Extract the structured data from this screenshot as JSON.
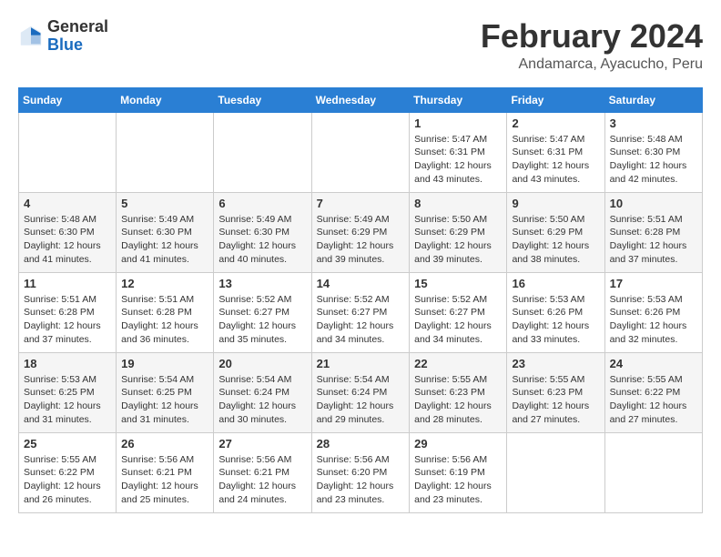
{
  "header": {
    "logo": {
      "general": "General",
      "blue": "Blue"
    },
    "title": "February 2024",
    "subtitle": "Andamarca, Ayacucho, Peru"
  },
  "days_of_week": [
    "Sunday",
    "Monday",
    "Tuesday",
    "Wednesday",
    "Thursday",
    "Friday",
    "Saturday"
  ],
  "weeks": [
    [
      {
        "day": "",
        "info": ""
      },
      {
        "day": "",
        "info": ""
      },
      {
        "day": "",
        "info": ""
      },
      {
        "day": "",
        "info": ""
      },
      {
        "day": "1",
        "info": "Sunrise: 5:47 AM\nSunset: 6:31 PM\nDaylight: 12 hours\nand 43 minutes."
      },
      {
        "day": "2",
        "info": "Sunrise: 5:47 AM\nSunset: 6:31 PM\nDaylight: 12 hours\nand 43 minutes."
      },
      {
        "day": "3",
        "info": "Sunrise: 5:48 AM\nSunset: 6:30 PM\nDaylight: 12 hours\nand 42 minutes."
      }
    ],
    [
      {
        "day": "4",
        "info": "Sunrise: 5:48 AM\nSunset: 6:30 PM\nDaylight: 12 hours\nand 41 minutes."
      },
      {
        "day": "5",
        "info": "Sunrise: 5:49 AM\nSunset: 6:30 PM\nDaylight: 12 hours\nand 41 minutes."
      },
      {
        "day": "6",
        "info": "Sunrise: 5:49 AM\nSunset: 6:30 PM\nDaylight: 12 hours\nand 40 minutes."
      },
      {
        "day": "7",
        "info": "Sunrise: 5:49 AM\nSunset: 6:29 PM\nDaylight: 12 hours\nand 39 minutes."
      },
      {
        "day": "8",
        "info": "Sunrise: 5:50 AM\nSunset: 6:29 PM\nDaylight: 12 hours\nand 39 minutes."
      },
      {
        "day": "9",
        "info": "Sunrise: 5:50 AM\nSunset: 6:29 PM\nDaylight: 12 hours\nand 38 minutes."
      },
      {
        "day": "10",
        "info": "Sunrise: 5:51 AM\nSunset: 6:28 PM\nDaylight: 12 hours\nand 37 minutes."
      }
    ],
    [
      {
        "day": "11",
        "info": "Sunrise: 5:51 AM\nSunset: 6:28 PM\nDaylight: 12 hours\nand 37 minutes."
      },
      {
        "day": "12",
        "info": "Sunrise: 5:51 AM\nSunset: 6:28 PM\nDaylight: 12 hours\nand 36 minutes."
      },
      {
        "day": "13",
        "info": "Sunrise: 5:52 AM\nSunset: 6:27 PM\nDaylight: 12 hours\nand 35 minutes."
      },
      {
        "day": "14",
        "info": "Sunrise: 5:52 AM\nSunset: 6:27 PM\nDaylight: 12 hours\nand 34 minutes."
      },
      {
        "day": "15",
        "info": "Sunrise: 5:52 AM\nSunset: 6:27 PM\nDaylight: 12 hours\nand 34 minutes."
      },
      {
        "day": "16",
        "info": "Sunrise: 5:53 AM\nSunset: 6:26 PM\nDaylight: 12 hours\nand 33 minutes."
      },
      {
        "day": "17",
        "info": "Sunrise: 5:53 AM\nSunset: 6:26 PM\nDaylight: 12 hours\nand 32 minutes."
      }
    ],
    [
      {
        "day": "18",
        "info": "Sunrise: 5:53 AM\nSunset: 6:25 PM\nDaylight: 12 hours\nand 31 minutes."
      },
      {
        "day": "19",
        "info": "Sunrise: 5:54 AM\nSunset: 6:25 PM\nDaylight: 12 hours\nand 31 minutes."
      },
      {
        "day": "20",
        "info": "Sunrise: 5:54 AM\nSunset: 6:24 PM\nDaylight: 12 hours\nand 30 minutes."
      },
      {
        "day": "21",
        "info": "Sunrise: 5:54 AM\nSunset: 6:24 PM\nDaylight: 12 hours\nand 29 minutes."
      },
      {
        "day": "22",
        "info": "Sunrise: 5:55 AM\nSunset: 6:23 PM\nDaylight: 12 hours\nand 28 minutes."
      },
      {
        "day": "23",
        "info": "Sunrise: 5:55 AM\nSunset: 6:23 PM\nDaylight: 12 hours\nand 27 minutes."
      },
      {
        "day": "24",
        "info": "Sunrise: 5:55 AM\nSunset: 6:22 PM\nDaylight: 12 hours\nand 27 minutes."
      }
    ],
    [
      {
        "day": "25",
        "info": "Sunrise: 5:55 AM\nSunset: 6:22 PM\nDaylight: 12 hours\nand 26 minutes."
      },
      {
        "day": "26",
        "info": "Sunrise: 5:56 AM\nSunset: 6:21 PM\nDaylight: 12 hours\nand 25 minutes."
      },
      {
        "day": "27",
        "info": "Sunrise: 5:56 AM\nSunset: 6:21 PM\nDaylight: 12 hours\nand 24 minutes."
      },
      {
        "day": "28",
        "info": "Sunrise: 5:56 AM\nSunset: 6:20 PM\nDaylight: 12 hours\nand 23 minutes."
      },
      {
        "day": "29",
        "info": "Sunrise: 5:56 AM\nSunset: 6:19 PM\nDaylight: 12 hours\nand 23 minutes."
      },
      {
        "day": "",
        "info": ""
      },
      {
        "day": "",
        "info": ""
      }
    ]
  ]
}
